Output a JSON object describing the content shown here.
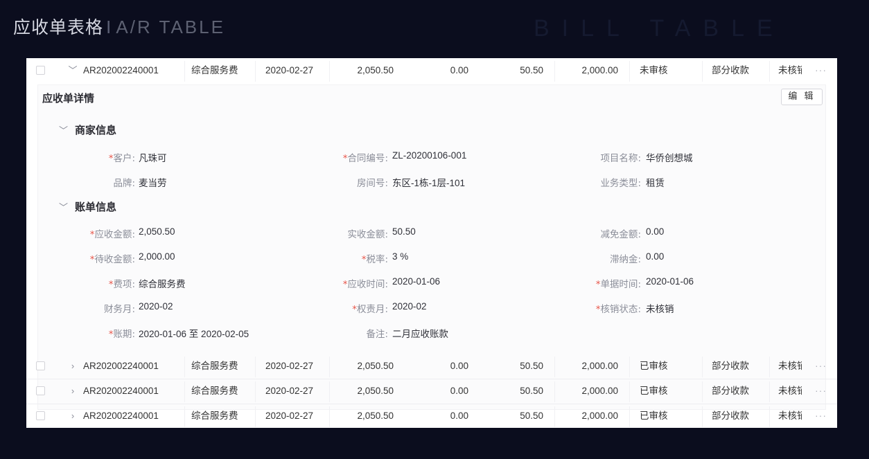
{
  "header": {
    "title": "应收单表格",
    "separator": "I",
    "subtitle": "A/R TABLE"
  },
  "background_text": "BILL TABLE",
  "table": {
    "rows": [
      {
        "id": "AR202002240001",
        "type": "综合服务费",
        "date": "2020-02-27",
        "receivable": "2,050.50",
        "reduction": "0.00",
        "received": "50.50",
        "pending": "2,000.00",
        "audit": "未审核",
        "collection": "部分收款",
        "writeoff": "未核销",
        "expanded": true
      },
      {
        "id": "AR202002240001",
        "type": "综合服务费",
        "date": "2020-02-27",
        "receivable": "2,050.50",
        "reduction": "0.00",
        "received": "50.50",
        "pending": "2,000.00",
        "audit": "已审核",
        "collection": "部分收款",
        "writeoff": "未核销",
        "expanded": false
      },
      {
        "id": "AR202002240001",
        "type": "综合服务费",
        "date": "2020-02-27",
        "receivable": "2,050.50",
        "reduction": "0.00",
        "received": "50.50",
        "pending": "2,000.00",
        "audit": "已审核",
        "collection": "部分收款",
        "writeoff": "未核销",
        "expanded": false
      },
      {
        "id": "AR202002240001",
        "type": "综合服务费",
        "date": "2020-02-27",
        "receivable": "2,050.50",
        "reduction": "0.00",
        "received": "50.50",
        "pending": "2,000.00",
        "audit": "已审核",
        "collection": "部分收款",
        "writeoff": "未核销",
        "expanded": false
      }
    ],
    "more_label": "···"
  },
  "detail": {
    "title": "应收单详情",
    "edit_label": "编 辑",
    "merchant": {
      "title": "商家信息",
      "fields": [
        {
          "label": "客户",
          "required": true,
          "value": "凡珠可"
        },
        {
          "label": "合同编号",
          "required": true,
          "value": "ZL-20200106-001"
        },
        {
          "label": "项目名称",
          "required": false,
          "value": "华侨创想城"
        },
        {
          "label": "品牌",
          "required": false,
          "value": "麦当劳"
        },
        {
          "label": "房间号",
          "required": false,
          "value": "东区-1栋-1层-101"
        },
        {
          "label": "业务类型",
          "required": false,
          "value": "租赁"
        }
      ]
    },
    "bill": {
      "title": "账单信息",
      "fields": [
        {
          "label": "应收金额",
          "required": true,
          "value": "2,050.50"
        },
        {
          "label": "实收金额",
          "required": false,
          "value": "50.50"
        },
        {
          "label": "减免金额",
          "required": false,
          "value": "0.00"
        },
        {
          "label": "待收金额",
          "required": true,
          "value": "2,000.00"
        },
        {
          "label": "税率",
          "required": true,
          "value": "3 %"
        },
        {
          "label": "滞纳金",
          "required": false,
          "value": "0.00"
        },
        {
          "label": "费项",
          "required": true,
          "value": "综合服务费"
        },
        {
          "label": "应收时间",
          "required": true,
          "value": "2020-01-06"
        },
        {
          "label": "单据时间",
          "required": true,
          "value": "2020-01-06"
        },
        {
          "label": "财务月",
          "required": false,
          "value": "2020-02"
        },
        {
          "label": "权责月",
          "required": true,
          "value": "2020-02"
        },
        {
          "label": "核销状态",
          "required": true,
          "value": "未核销"
        },
        {
          "label": "账期",
          "required": true,
          "value": "2020-01-06 至 2020-02-05"
        },
        {
          "label": "备注",
          "required": false,
          "value": "二月应收账款"
        }
      ]
    }
  },
  "colors": {
    "page_bg": "#0b0d1e",
    "panel_bg": "#ffffff",
    "required_star": "#e8564a",
    "label": "#8b8e99"
  }
}
